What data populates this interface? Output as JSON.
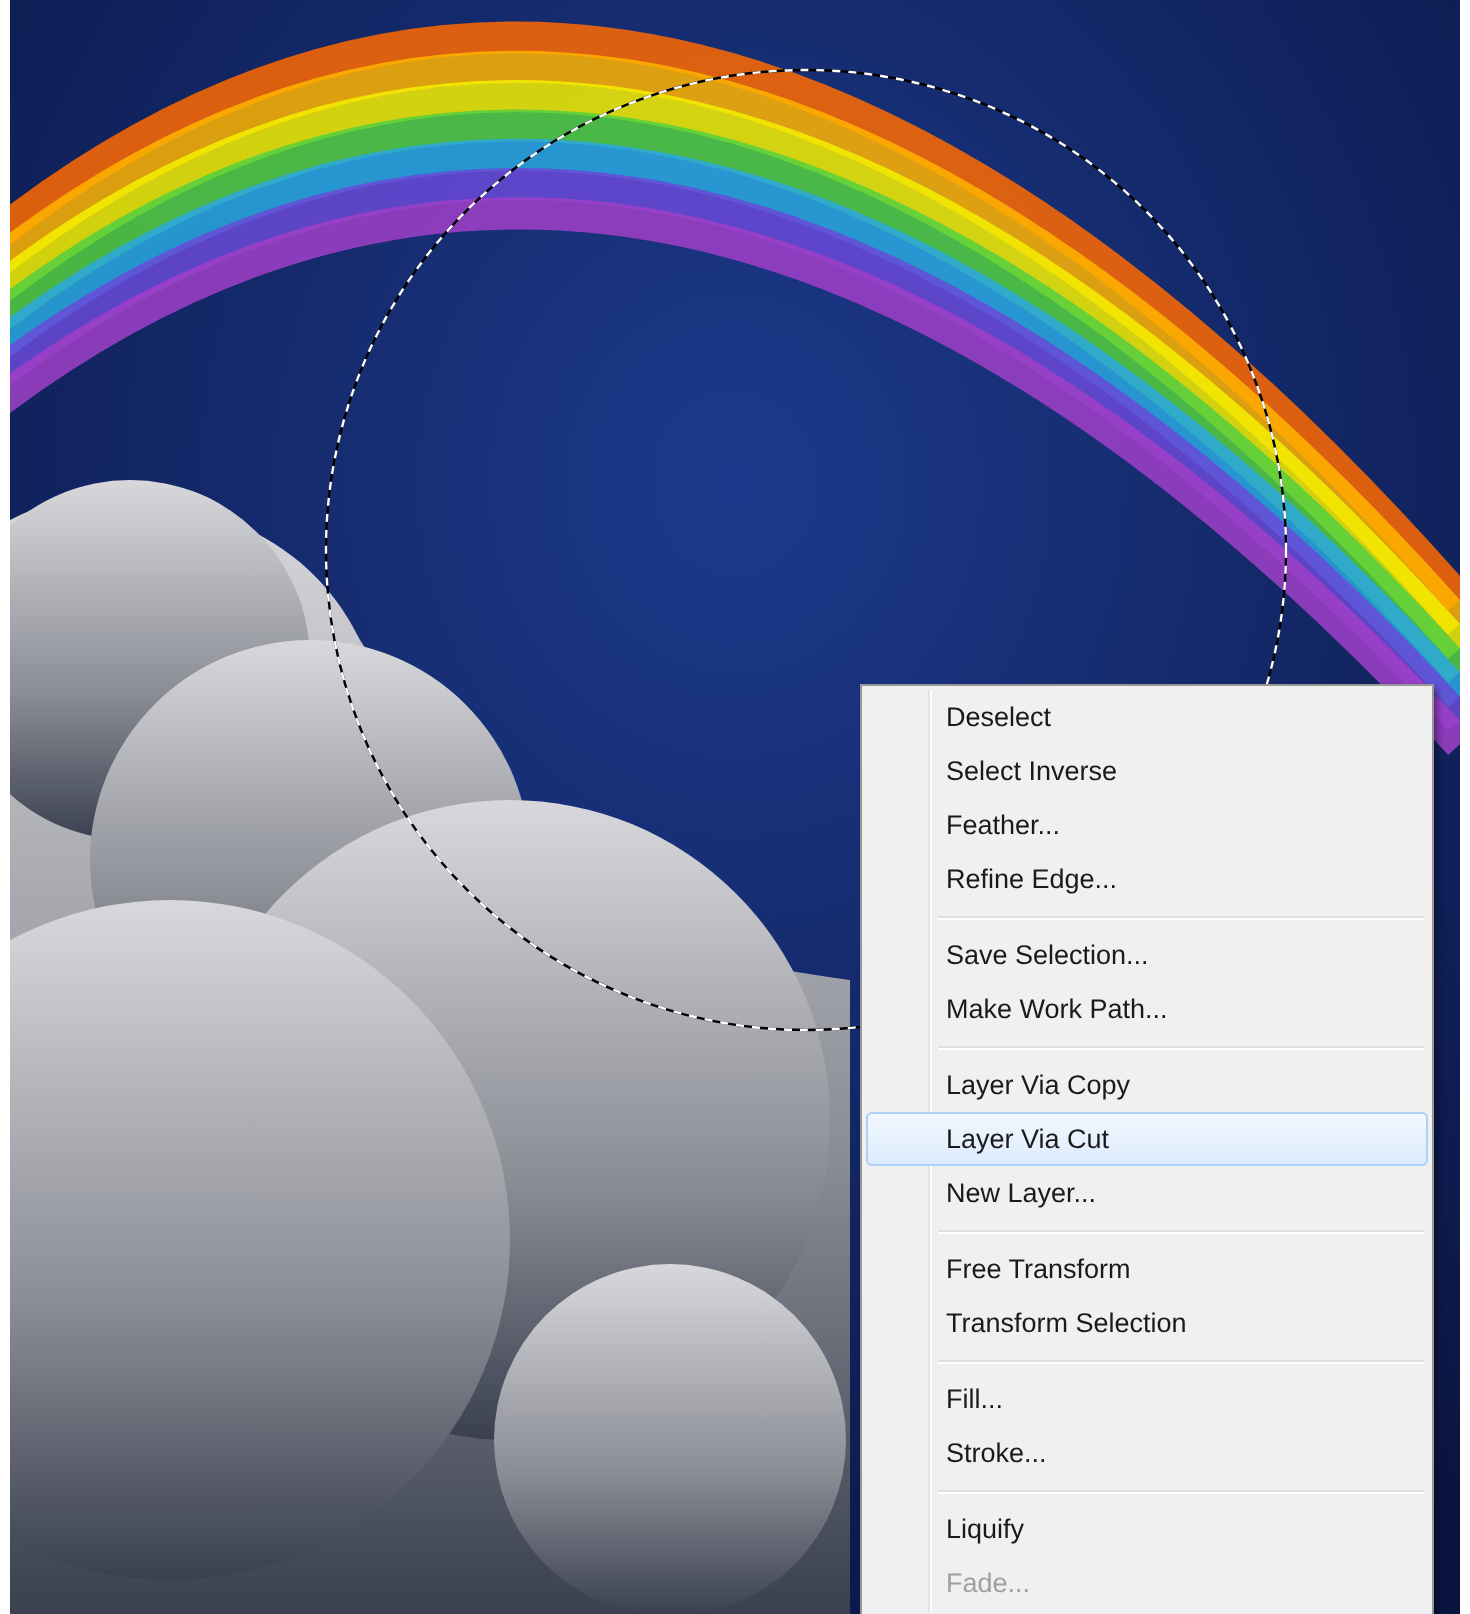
{
  "context_menu": {
    "groups": [
      [
        {
          "label": "Deselect",
          "selected": false,
          "disabled": false
        },
        {
          "label": "Select Inverse",
          "selected": false,
          "disabled": false
        },
        {
          "label": "Feather...",
          "selected": false,
          "disabled": false
        },
        {
          "label": "Refine Edge...",
          "selected": false,
          "disabled": false
        }
      ],
      [
        {
          "label": "Save Selection...",
          "selected": false,
          "disabled": false
        },
        {
          "label": "Make Work Path...",
          "selected": false,
          "disabled": false
        }
      ],
      [
        {
          "label": "Layer Via Copy",
          "selected": false,
          "disabled": false
        },
        {
          "label": "Layer Via Cut",
          "selected": true,
          "disabled": false
        },
        {
          "label": "New Layer...",
          "selected": false,
          "disabled": false
        }
      ],
      [
        {
          "label": "Free Transform",
          "selected": false,
          "disabled": false
        },
        {
          "label": "Transform Selection",
          "selected": false,
          "disabled": false
        }
      ],
      [
        {
          "label": "Fill...",
          "selected": false,
          "disabled": false
        },
        {
          "label": "Stroke...",
          "selected": false,
          "disabled": false
        }
      ],
      [
        {
          "label": "Liquify",
          "selected": false,
          "disabled": false
        },
        {
          "label": "Fade...",
          "selected": false,
          "disabled": true
        }
      ]
    ]
  }
}
